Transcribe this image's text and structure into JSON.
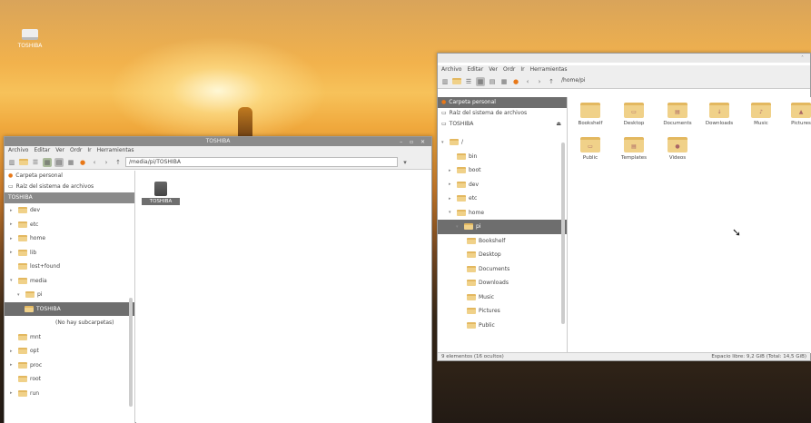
{
  "desktop": {
    "icon_label": "TOSHIBA"
  },
  "left_window": {
    "title": "TOSHIBA",
    "menu": [
      "Archivo",
      "Editar",
      "Ver",
      "Ordr",
      "Ir",
      "Herramientas"
    ],
    "path": "/media/pi/TOSHIBA",
    "places": [
      {
        "label": "Carpeta personal",
        "icon": "home-icon"
      },
      {
        "label": "Raíz del sistema de archivos",
        "icon": "drive-icon"
      }
    ],
    "tree_header": "TOSHIBA",
    "tree": [
      {
        "label": "dev",
        "expanded": false
      },
      {
        "label": "etc",
        "expanded": false
      },
      {
        "label": "home",
        "expanded": false
      },
      {
        "label": "lib",
        "expanded": false
      },
      {
        "label": "lost+found",
        "expanded": false
      },
      {
        "label": "media",
        "expanded": true
      },
      {
        "label": "pi",
        "expanded": true
      },
      {
        "label": "TOSHIBA",
        "selected": true
      },
      {
        "label": "(No hay subcarpetas)",
        "note": true
      },
      {
        "label": "mnt",
        "expanded": false
      },
      {
        "label": "opt",
        "expanded": false
      },
      {
        "label": "proc",
        "expanded": false
      },
      {
        "label": "root",
        "expanded": false
      },
      {
        "label": "run",
        "expanded": false
      }
    ],
    "file_label": "TOSHIBA"
  },
  "right_window": {
    "title": "",
    "menu": [
      "Archivo",
      "Editar",
      "Ver",
      "Ordr",
      "Ir",
      "Herramientas"
    ],
    "path": "/home/pi",
    "places": [
      {
        "label": "Carpeta personal",
        "icon": "home-icon",
        "selected": true
      },
      {
        "label": "Raíz del sistema de archivos",
        "icon": "drive-icon"
      },
      {
        "label": "TOSHIBA",
        "icon": "drive-icon"
      }
    ],
    "tree": [
      {
        "label": "/",
        "expanded": true,
        "indent": 0
      },
      {
        "label": "bin",
        "indent": 1
      },
      {
        "label": "boot",
        "indent": 1
      },
      {
        "label": "dev",
        "indent": 1
      },
      {
        "label": "etc",
        "indent": 1
      },
      {
        "label": "home",
        "indent": 1,
        "expanded": true
      },
      {
        "label": "pi",
        "indent": 2,
        "selected": true
      },
      {
        "label": "Bookshelf",
        "indent": 3
      },
      {
        "label": "Desktop",
        "indent": 3
      },
      {
        "label": "Documents",
        "indent": 3
      },
      {
        "label": "Downloads",
        "indent": 3
      },
      {
        "label": "Music",
        "indent": 3
      },
      {
        "label": "Pictures",
        "indent": 3
      },
      {
        "label": "Public",
        "indent": 3
      }
    ],
    "items": [
      {
        "label": "Bookshelf"
      },
      {
        "label": "Desktop"
      },
      {
        "label": "Documents"
      },
      {
        "label": "Downloads"
      },
      {
        "label": "Music"
      },
      {
        "label": "Pictures"
      },
      {
        "label": "Public"
      },
      {
        "label": "Templates"
      },
      {
        "label": "Videos"
      }
    ],
    "status_left": "9 elementos (16 ocultos)",
    "status_right": "Espacio libre: 9,2 GiB (Total: 14,5 GiB)"
  }
}
